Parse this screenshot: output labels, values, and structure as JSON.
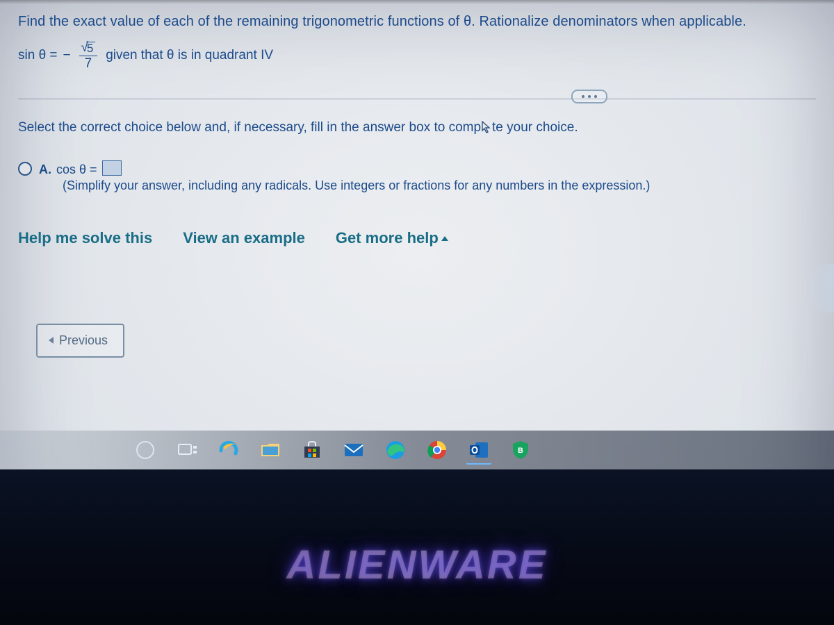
{
  "problem": {
    "instruction": "Find the exact value of each of the remaining trigonometric functions of θ. Rationalize denominators when applicable.",
    "sin_label": "sin θ =",
    "minus": "−",
    "sqrt_sym": "√",
    "sqrt_arg": "5",
    "denominator": "7",
    "given_text": "given that θ is in quadrant IV"
  },
  "select_text_pre": "Select the correct choice below and, if necessary, fill in the answer box to comp",
  "select_text_post": "te your choice.",
  "choice_a": {
    "label": "A.",
    "expr": "cos θ =",
    "hint": "(Simplify your answer, including any radicals. Use integers or fractions for any numbers in the expression.)"
  },
  "help": {
    "solve": "Help me solve this",
    "example": "View an example",
    "more": "Get more help"
  },
  "prev_label": "Previous",
  "brand": "ALIENWARE"
}
